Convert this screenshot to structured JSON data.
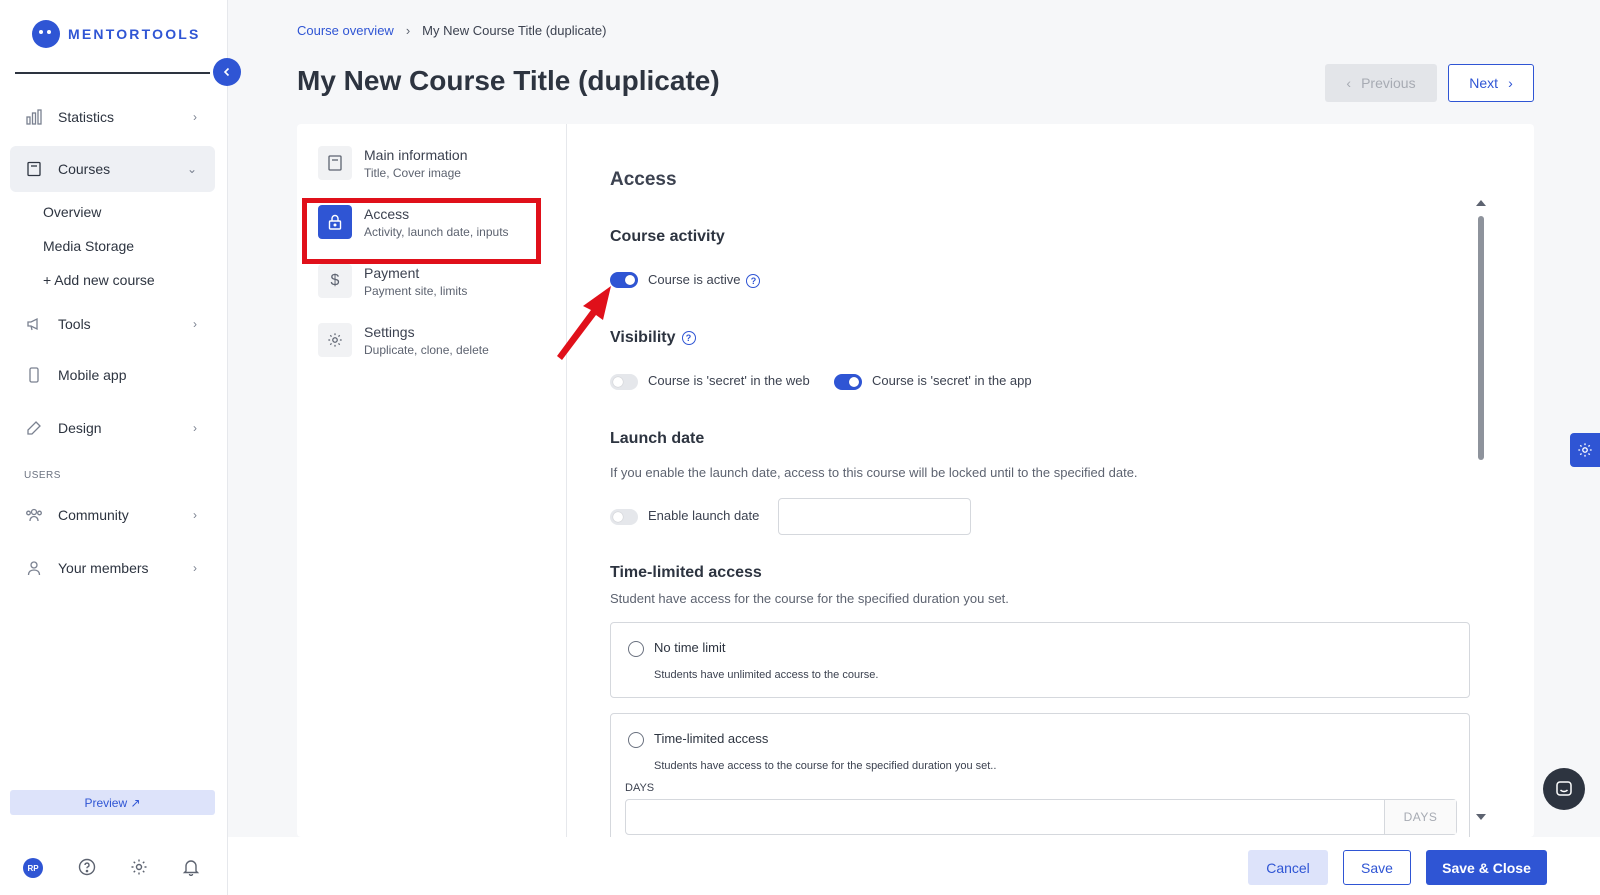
{
  "app": {
    "logo_text": "MENTORTOOLS",
    "brand_color": "#2f55d4"
  },
  "sidebar": {
    "items": [
      {
        "label": "Statistics",
        "icon": "bar-chart-icon"
      },
      {
        "label": "Courses",
        "icon": "book-icon",
        "active": true
      },
      {
        "label": "Tools",
        "icon": "megaphone-icon"
      },
      {
        "label": "Mobile app",
        "icon": "phone-icon"
      },
      {
        "label": "Design",
        "icon": "pen-icon"
      },
      {
        "label": "Community",
        "icon": "people-icon"
      },
      {
        "label": "Your members",
        "icon": "user-icon"
      }
    ],
    "courses_sub": [
      "Overview",
      "Media Storage",
      "+ Add new course"
    ],
    "section_users": "USERS",
    "preview_label": "Preview ↗",
    "avatar_initials": "RP"
  },
  "header": {
    "breadcrumb_link": "Course overview",
    "breadcrumb_sep": "›",
    "breadcrumb_current": "My New Course Title (duplicate)",
    "title": "My New Course Title (duplicate)",
    "previous_label": "Previous",
    "next_label": "Next"
  },
  "steps": [
    {
      "title": "Main information",
      "subtitle": "Title, Cover image"
    },
    {
      "title": "Access",
      "subtitle": "Activity, launch date, inputs",
      "active": true
    },
    {
      "title": "Payment",
      "subtitle": "Payment site, limits"
    },
    {
      "title": "Settings",
      "subtitle": "Duplicate, clone, delete"
    }
  ],
  "content": {
    "section_title": "Access",
    "course_activity": {
      "heading": "Course activity",
      "toggle_label": "Course is active",
      "on": true
    },
    "visibility": {
      "heading": "Visibility",
      "web_label": "Course is 'secret' in the web",
      "web_on": false,
      "app_label": "Course is 'secret' in the app",
      "app_on": true
    },
    "launch_date": {
      "heading": "Launch date",
      "description": "If you enable the launch date, access to this course will be locked until to the specified date.",
      "toggle_label": "Enable launch date",
      "on": false,
      "value": ""
    },
    "time_limited": {
      "heading": "Time-limited access",
      "description": "Student have access for the course for the specified duration you set.",
      "options": [
        {
          "title": "No time limit",
          "description": "Students have unlimited access to the course."
        },
        {
          "title": "Time-limited access",
          "description": "Students have access to the course for the specified duration you set.."
        }
      ],
      "days_label": "DAYS",
      "days_suffix": "DAYS",
      "days_value": ""
    }
  },
  "footer": {
    "cancel_label": "Cancel",
    "save_label": "Save",
    "save_close_label": "Save & Close"
  }
}
